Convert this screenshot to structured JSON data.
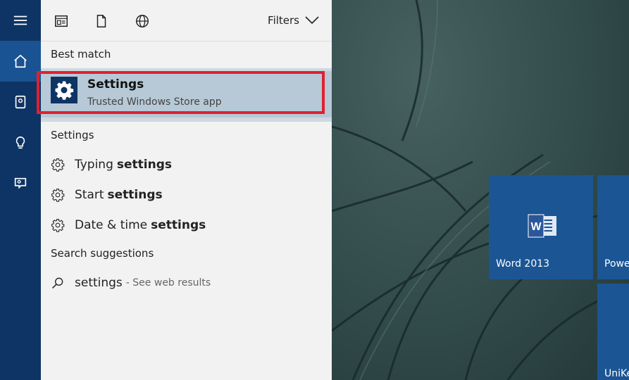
{
  "toolbar": {
    "icons": [
      "apps-icon",
      "document-icon",
      "web-globe-icon"
    ],
    "filters_label": "Filters"
  },
  "sidebar": {
    "items": [
      "home-icon",
      "notebook-icon",
      "lightbulb-icon",
      "feedback-icon"
    ],
    "active": "home-icon"
  },
  "best_match": {
    "heading": "Best match",
    "title": "Settings",
    "subtitle": "Trusted Windows Store app",
    "highlight_color": "#e02030"
  },
  "settings_section": {
    "heading": "Settings",
    "items": [
      {
        "prefix": "Typing",
        "bold": "settings"
      },
      {
        "prefix": "Start",
        "bold": "settings"
      },
      {
        "prefix": "Date & time",
        "bold": "settings"
      }
    ]
  },
  "suggestions": {
    "heading": "Search suggestions",
    "query": "settings",
    "web_hint": "- See web results"
  },
  "tiles": [
    {
      "label": "Word 2013",
      "icon": "word-icon"
    },
    {
      "label": "Powe"
    },
    {
      "label": "UniKe"
    }
  ],
  "colors": {
    "rail": "#0d3464",
    "rail_active": "#1a5393",
    "tile": "#1b5594",
    "selection": "#b7c9d6"
  }
}
